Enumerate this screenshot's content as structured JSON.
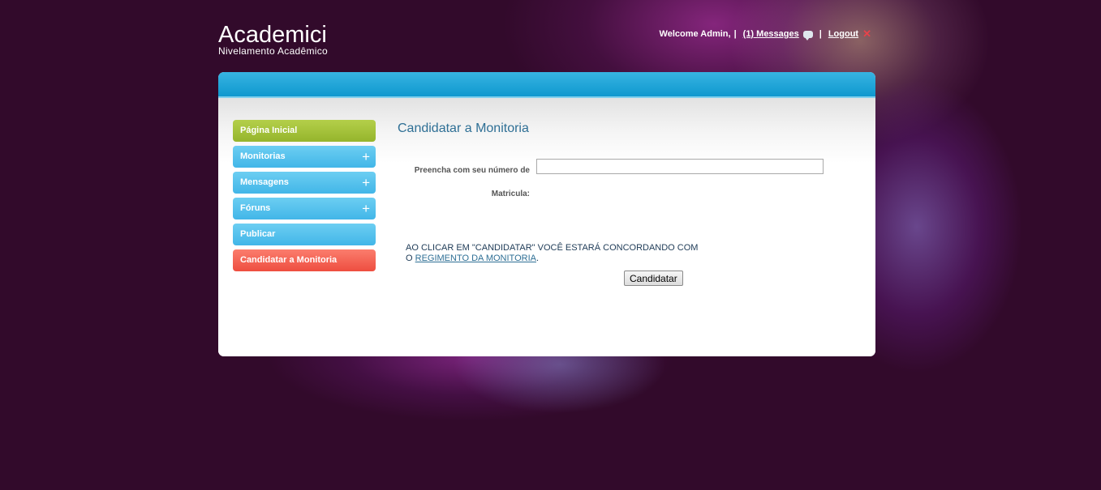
{
  "brand": {
    "title": "Academici",
    "subtitle": "Nivelamento Acadêmico"
  },
  "topbar": {
    "welcome": "Welcome Admin,",
    "separator": "|",
    "messages_link": "(1) Messages",
    "logout_link": "Logout"
  },
  "sidebar": {
    "items": [
      {
        "label": "Página Inicial",
        "expandable": false
      },
      {
        "label": "Monitorias",
        "expandable": true
      },
      {
        "label": "Mensagens",
        "expandable": true
      },
      {
        "label": "Fóruns",
        "expandable": true
      },
      {
        "label": "Publicar",
        "expandable": false
      },
      {
        "label": "Candidatar a Monitoria",
        "expandable": false,
        "active": true
      }
    ],
    "plus_symbol": "+"
  },
  "main": {
    "title": "Candidatar a Monitoria",
    "form": {
      "label_line1": "Preencha com seu número de",
      "label_line2": "Matricula:",
      "input_value": "",
      "submit_label": "Candidatar"
    },
    "notice": {
      "text_line1": "AO CLICAR EM \"CANDIDATAR\" VOCÊ ESTARÁ CONCORDANDO COM",
      "text_prefix": "O",
      "link_text": "REGIMENTO DA MONITORIA",
      "text_suffix": "."
    }
  },
  "colors": {
    "background": "#320a2b",
    "header_blue": "#1ea6d8",
    "nav_green": "#a3c23a",
    "nav_blue": "#55c1ec",
    "nav_active": "#f5645a",
    "title_blue": "#2e6f95"
  },
  "icons": {
    "messages": "speech-bubble-icon",
    "logout": "close-x-icon",
    "expand": "plus-icon"
  }
}
